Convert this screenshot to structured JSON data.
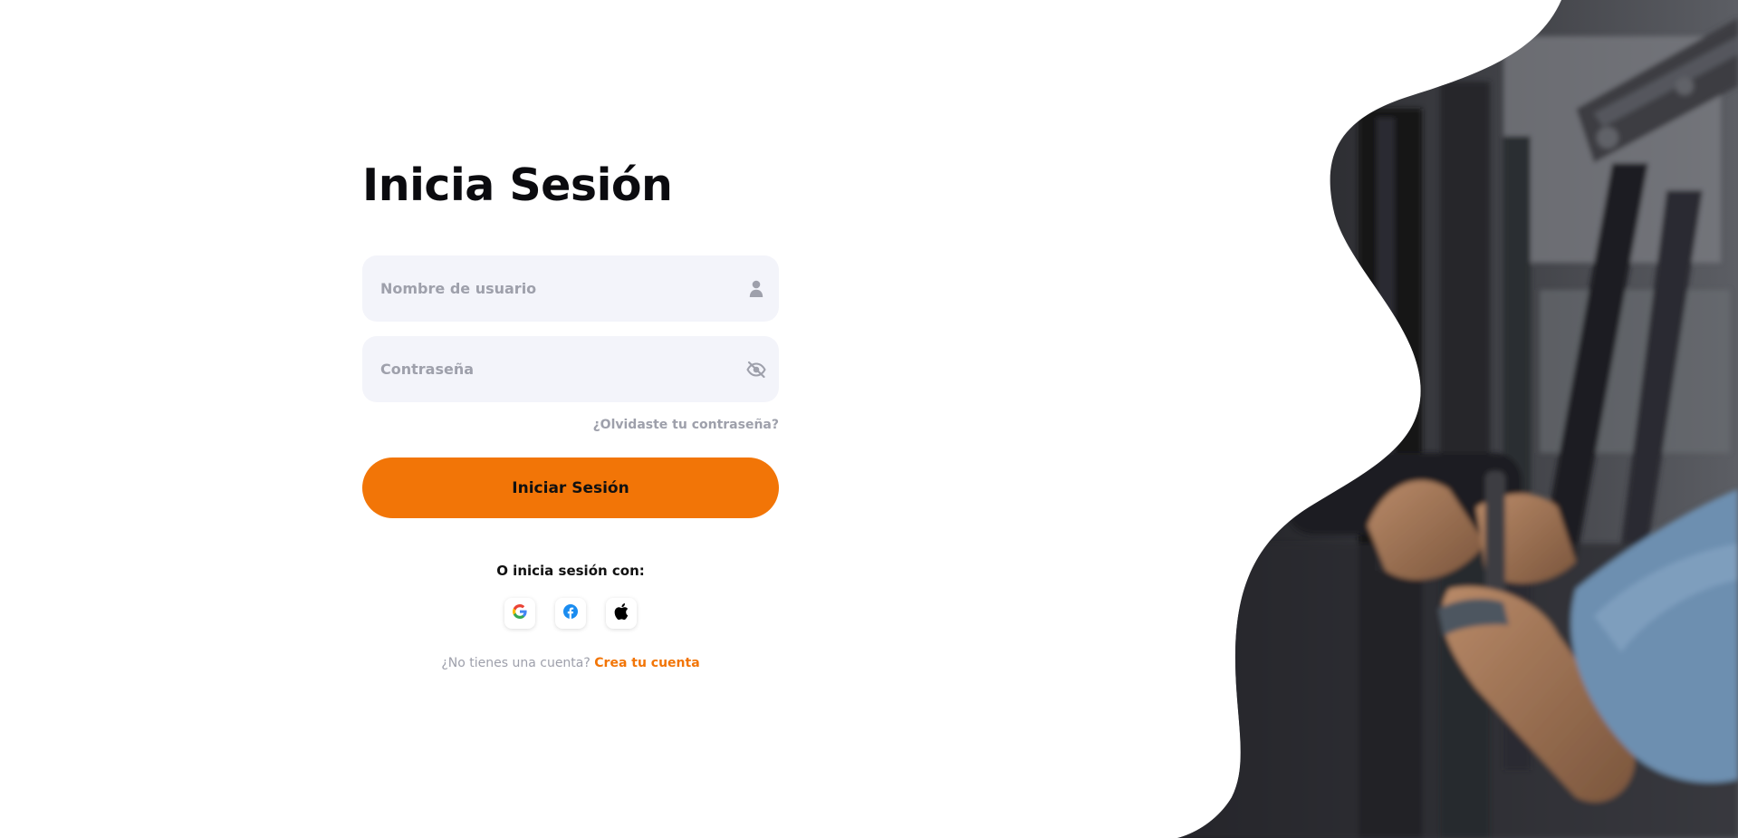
{
  "login": {
    "title": "Inicia Sesión",
    "username_placeholder": "Nombre de usuario",
    "password_placeholder": "Contraseña",
    "forgot_label": "¿Olvidaste tu contraseña?",
    "submit_label": "Iniciar Sesión",
    "social_title": "O inicia sesión con:",
    "social_providers": [
      "google-icon",
      "facebook-icon",
      "apple-icon"
    ],
    "signup_prompt": "¿No tienes una cuenta?",
    "signup_link": "Crea tu cuenta"
  },
  "icons": {
    "username": "user-icon",
    "password": "eye-off-icon"
  },
  "colors": {
    "accent": "#f27507",
    "field_bg": "#f3f4fa",
    "muted_text": "#9ea0ab",
    "title_text": "#0b0b0f"
  }
}
